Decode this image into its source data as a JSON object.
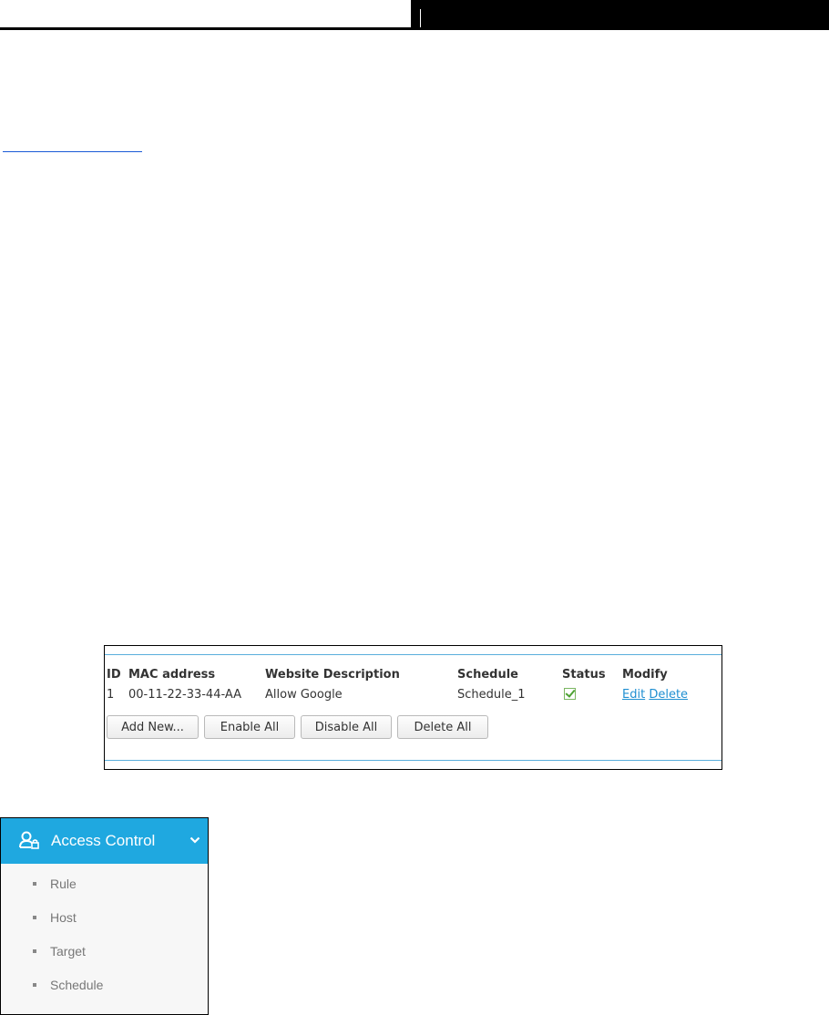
{
  "rule_table": {
    "headers": [
      "ID",
      "MAC address",
      "Website Description",
      "Schedule",
      "Status",
      "Modify"
    ],
    "rows": [
      {
        "id": "1",
        "mac": "00-11-22-33-44-AA",
        "description": "Allow Google",
        "schedule": "Schedule_1",
        "status": "enabled",
        "edit": "Edit",
        "delete": "Delete"
      }
    ],
    "buttons": {
      "add_new": "Add New...",
      "enable_all": "Enable All",
      "disable_all": "Disable All",
      "delete_all": "Delete All"
    }
  },
  "menu": {
    "title": "Access Control",
    "icon": "access-control-icon",
    "expanded": true,
    "items": [
      {
        "label": "Rule"
      },
      {
        "label": "Host"
      },
      {
        "label": "Target"
      },
      {
        "label": "Schedule"
      }
    ]
  },
  "colors": {
    "accent": "#1fa8e0",
    "link": "#1f8fd1",
    "status_check": "#4ea233"
  }
}
